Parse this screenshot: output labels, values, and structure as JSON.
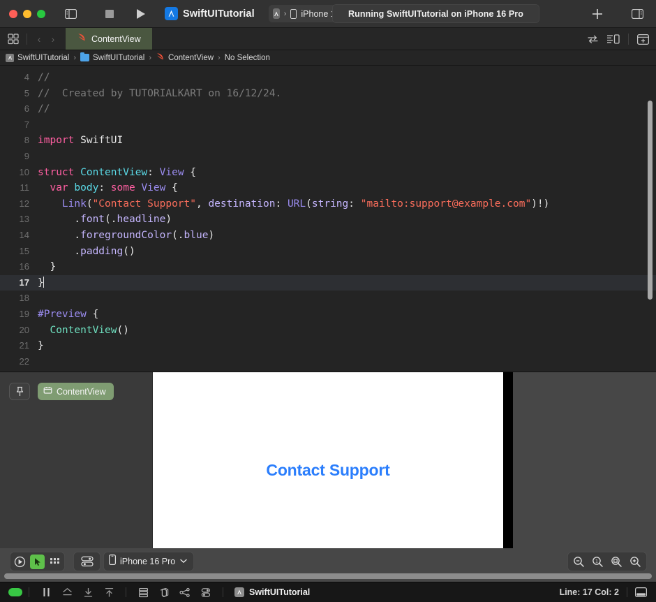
{
  "titlebar": {
    "sidebar_toggle": "toggle-navigator",
    "stop_button": "stop",
    "run_button": "run",
    "scheme_name": "SwiftUITutorial",
    "destination_label": "iPhone 1",
    "destination_separator": "›",
    "status_text": "Running SwiftUITutorial on iPhone 16 Pro",
    "add_button": "+",
    "inspector_toggle": "toggle-inspector"
  },
  "tabbar": {
    "grid_button": "tab-grid",
    "back_arrow": "‹",
    "forward_arrow": "›",
    "active_tab": "ContentView",
    "right_icons": [
      "swap-editors-icon",
      "editor-options-icon",
      "add-editor-icon"
    ]
  },
  "breadcrumb": {
    "items": [
      {
        "label": "SwiftUITutorial",
        "icon": "project-icon"
      },
      {
        "label": "SwiftUITutorial",
        "icon": "folder-icon"
      },
      {
        "label": "ContentView",
        "icon": "swift-file-icon"
      },
      {
        "label": "No Selection",
        "icon": "none"
      }
    ],
    "separator": "›"
  },
  "editor": {
    "first_visible_line": 4,
    "active_line": 17,
    "lines": [
      {
        "n": 4,
        "segments": [
          {
            "t": "//",
            "c": "cmt"
          }
        ]
      },
      {
        "n": 5,
        "segments": [
          {
            "t": "//  Created by TUTORIALKART on 16/12/24.",
            "c": "cmt"
          }
        ]
      },
      {
        "n": 6,
        "segments": [
          {
            "t": "//",
            "c": "cmt"
          }
        ]
      },
      {
        "n": 7,
        "segments": []
      },
      {
        "n": 8,
        "segments": [
          {
            "t": "import",
            "c": "kw"
          },
          {
            "t": " ",
            "c": "plain"
          },
          {
            "t": "SwiftUI",
            "c": "plain"
          }
        ]
      },
      {
        "n": 9,
        "segments": []
      },
      {
        "n": 10,
        "segments": [
          {
            "t": "struct",
            "c": "kw"
          },
          {
            "t": " ",
            "c": "plain"
          },
          {
            "t": "ContentView",
            "c": "decl"
          },
          {
            "t": ": ",
            "c": "plain"
          },
          {
            "t": "View",
            "c": "type"
          },
          {
            "t": " {",
            "c": "plain"
          }
        ]
      },
      {
        "n": 11,
        "segments": [
          {
            "t": "  ",
            "c": "plain"
          },
          {
            "t": "var",
            "c": "kw"
          },
          {
            "t": " ",
            "c": "plain"
          },
          {
            "t": "body",
            "c": "decl"
          },
          {
            "t": ": ",
            "c": "plain"
          },
          {
            "t": "some",
            "c": "kw"
          },
          {
            "t": " ",
            "c": "plain"
          },
          {
            "t": "View",
            "c": "type"
          },
          {
            "t": " {",
            "c": "plain"
          }
        ]
      },
      {
        "n": 12,
        "segments": [
          {
            "t": "    ",
            "c": "plain"
          },
          {
            "t": "Link",
            "c": "type"
          },
          {
            "t": "(",
            "c": "plain"
          },
          {
            "t": "\"Contact Support\"",
            "c": "str"
          },
          {
            "t": ", ",
            "c": "plain"
          },
          {
            "t": "destination",
            "c": "arg"
          },
          {
            "t": ": ",
            "c": "plain"
          },
          {
            "t": "URL",
            "c": "type"
          },
          {
            "t": "(",
            "c": "plain"
          },
          {
            "t": "string",
            "c": "arg"
          },
          {
            "t": ": ",
            "c": "plain"
          },
          {
            "t": "\"mailto:support@example.com\"",
            "c": "str"
          },
          {
            "t": ")!)",
            "c": "plain"
          }
        ]
      },
      {
        "n": 13,
        "segments": [
          {
            "t": "      .",
            "c": "plain"
          },
          {
            "t": "font",
            "c": "arg"
          },
          {
            "t": "(.",
            "c": "plain"
          },
          {
            "t": "headline",
            "c": "arg"
          },
          {
            "t": ")",
            "c": "plain"
          }
        ]
      },
      {
        "n": 14,
        "segments": [
          {
            "t": "      .",
            "c": "plain"
          },
          {
            "t": "foregroundColor",
            "c": "arg"
          },
          {
            "t": "(.",
            "c": "plain"
          },
          {
            "t": "blue",
            "c": "arg"
          },
          {
            "t": ")",
            "c": "plain"
          }
        ]
      },
      {
        "n": 15,
        "segments": [
          {
            "t": "      .",
            "c": "plain"
          },
          {
            "t": "padding",
            "c": "arg"
          },
          {
            "t": "()",
            "c": "plain"
          }
        ]
      },
      {
        "n": 16,
        "segments": [
          {
            "t": "  }",
            "c": "plain"
          }
        ]
      },
      {
        "n": 17,
        "segments": [
          {
            "t": "}",
            "c": "plain"
          }
        ],
        "caret": true
      },
      {
        "n": 18,
        "segments": []
      },
      {
        "n": 19,
        "segments": [
          {
            "t": "#Preview",
            "c": "macro"
          },
          {
            "t": " {",
            "c": "plain"
          }
        ]
      },
      {
        "n": 20,
        "segments": [
          {
            "t": "  ",
            "c": "plain"
          },
          {
            "t": "ContentView",
            "c": "mint"
          },
          {
            "t": "()",
            "c": "plain"
          }
        ]
      },
      {
        "n": 21,
        "segments": [
          {
            "t": "}",
            "c": "plain"
          }
        ]
      },
      {
        "n": 22,
        "segments": []
      }
    ]
  },
  "canvas": {
    "pin_button": "pin-preview",
    "preview_pill_label": "ContentView",
    "preview_content_text": "Contact Support",
    "preview_link_color": "#2b7efc",
    "toolbar": {
      "live_preview": "play-preview",
      "selectable_mode": "pointer-select",
      "variants": "preview-variants",
      "device_settings": "device-settings",
      "device_label": "iPhone 16 Pro",
      "device_chevron": "⌄",
      "zoom_buttons": [
        "zoom-out-icon",
        "zoom-100-icon",
        "zoom-fit-icon",
        "zoom-in-icon"
      ]
    }
  },
  "statusbar": {
    "indicator": "build-success",
    "buttons": [
      "pause-icon",
      "hide-debug-area-icon",
      "step-over-icon",
      "step-into-icon",
      "variables-view-icon",
      "memory-graph-icon",
      "debug-hierarchy-icon",
      "environment-overrides-icon"
    ],
    "project_name": "SwiftUITutorial",
    "line_col_text": "Line: 17  Col: 2",
    "panel_toggle": "toggle-debug-area"
  },
  "colors": {
    "accent_green": "#7f9c72",
    "tab_active_bg": "#4a5740",
    "link_blue": "#2b7efc",
    "scheme_blue": "#1479e3"
  }
}
